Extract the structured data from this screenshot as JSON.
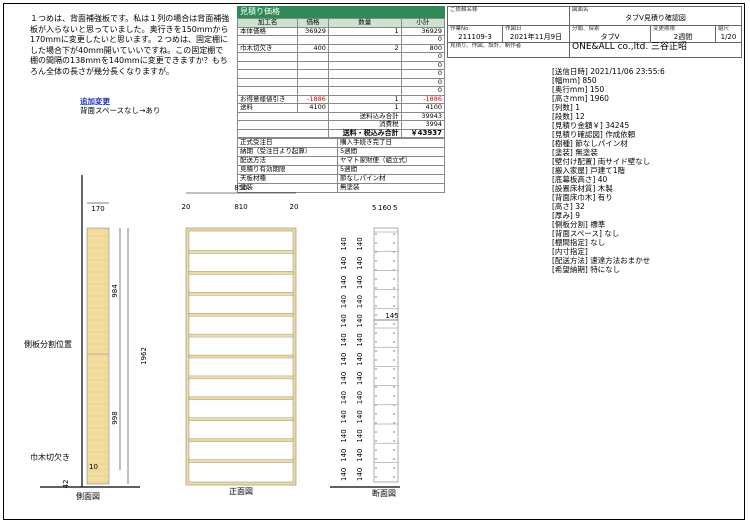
{
  "note": {
    "text": "１つめは、背面補強板です。私は１列の場合は背面補強板が入らないと思っていました。奥行きを150mmから170mmに変更したいと思います。２つめは、固定棚にした場合下が40mm開いていいですね。この固定棚で棚の間隔の138mmを140mmに変更できますか？もちろん全体の長さが幾分長くなりますが。"
  },
  "change": {
    "title": "追加変更",
    "body": "背面スペースなし→あり"
  },
  "estimate": {
    "title": "見積り価格",
    "headers": [
      "加工名",
      "価格",
      "数量",
      "小計"
    ],
    "rows": [
      {
        "name": "本体価格",
        "price": "36929",
        "qty": "1",
        "sub": "36929"
      },
      {
        "name": "",
        "price": "",
        "qty": "",
        "sub": "0"
      },
      {
        "name": "巾木切欠き",
        "price": "400",
        "qty": "2",
        "sub": "800"
      },
      {
        "name": "",
        "price": "",
        "qty": "",
        "sub": "0"
      },
      {
        "name": "",
        "price": "",
        "qty": "",
        "sub": "0"
      },
      {
        "name": "",
        "price": "",
        "qty": "",
        "sub": "0"
      },
      {
        "name": "",
        "price": "",
        "qty": "",
        "sub": "0"
      },
      {
        "name": "",
        "price": "",
        "qty": "",
        "sub": "0"
      },
      {
        "name": "お得意様値引き",
        "price": "-1886",
        "qty": "1",
        "sub": "-1886"
      },
      {
        "name": "送料",
        "price": "4100",
        "qty": "1",
        "sub": "4100"
      }
    ],
    "subtotal_label": "送料込み合計",
    "subtotal": "39943",
    "tax_label": "消費税",
    "tax": "3994",
    "total_label": "送料・税込み合計",
    "total": "￥43937"
  },
  "info": [
    {
      "k": "正式受注日",
      "v": "購入手続き完了日"
    },
    {
      "k": "納期（受注日より起算）",
      "v": "5週間"
    },
    {
      "k": "配送方法",
      "v": "ヤマト家財便（組立式）"
    },
    {
      "k": "見積り有効期限",
      "v": "5週間"
    },
    {
      "k": "天板材種",
      "v": "節なしパイン材"
    },
    {
      "k": "塗装",
      "v": "無塗装"
    }
  ],
  "titleblock": {
    "customer_label": "ご依頼名様",
    "customer": "",
    "drawing_label": "図面名",
    "drawing": "タブV見積り確認図",
    "workno_label": "作業No.",
    "workno": "211109-3",
    "date_label": "作図日",
    "date": "2021年11月9日",
    "category_label": "分類、探索",
    "category": "タブV",
    "period_label": "変更期限",
    "period": "2週間",
    "scale_label": "縮尺",
    "scale": "1/20",
    "company_label": "見積り、作図、設計、制作者",
    "company": "ONE&ALL co.,ltd. 三谷正昭"
  },
  "spec": [
    "[送信日時] 2021/11/06 23:55:6",
    "[幅mm] 850",
    "[奥行mm] 150",
    "[高さmm] 1960",
    "[列数] 1",
    "[段数] 12",
    "[見積り金額￥] 34245",
    "[見積り確認図] 作成依頼",
    "[樹種] 節なしパイン材",
    "[塗装] 無塗装",
    "[壁付け配置] 両サイド壁なし",
    "[搬入家屋] 戸建て1階",
    "[底幕板高さ] 40",
    "[設置床材質] 木製",
    "[背面床巾木] 有り",
    "[高さ] 32",
    "[厚み] 9",
    "[側板分割] 標準",
    "[背面スペース] なし",
    "[棚間指定] なし",
    "[内寸指定]",
    "[配送方法] 速達方法おまかせ",
    "[希望納期] 特になし"
  ],
  "drawing": {
    "side_view": "側面図",
    "front_view": "正面図",
    "section_view": "断面図",
    "split_label": "側板分割位置",
    "baseboard_label": "巾木切欠き",
    "side_width": "170",
    "side_upper": "984",
    "side_total": "1962",
    "side_lower": "998",
    "side_small": "10",
    "side_base": "42",
    "front_width": "850",
    "front_left": "20",
    "front_inner": "810",
    "front_right": "20",
    "sec_top_a": "5",
    "sec_top_b": "160",
    "sec_top_c": "5",
    "sec_pitch": "140",
    "sec_depth": "145"
  }
}
